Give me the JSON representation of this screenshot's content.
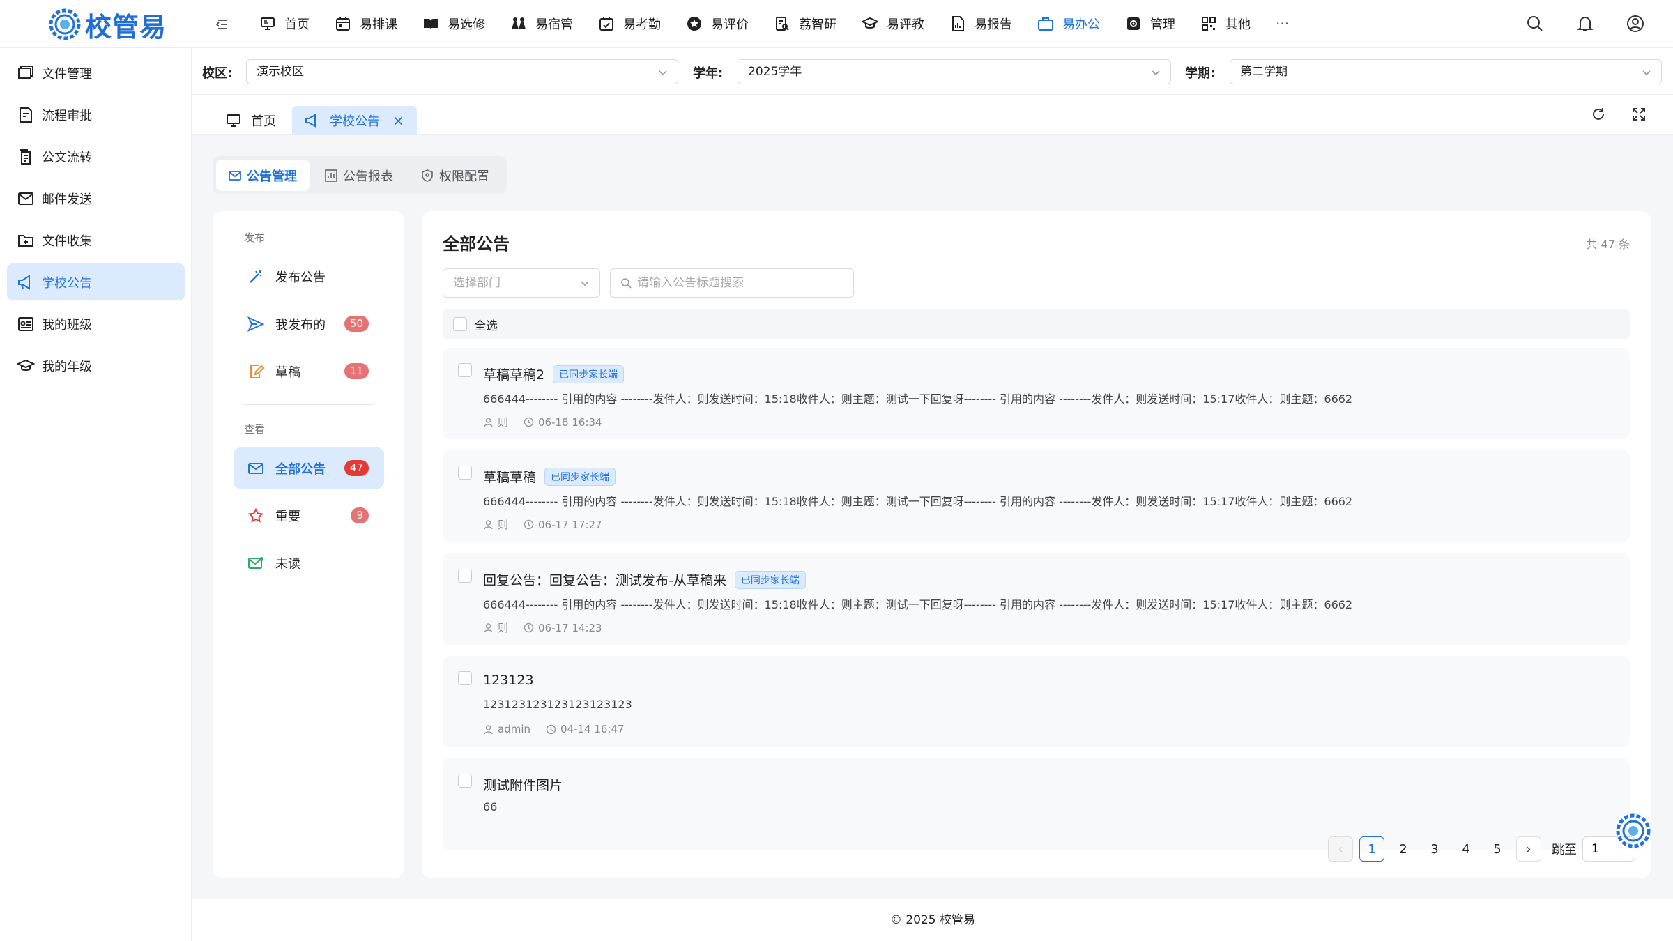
{
  "brand": {
    "name": "校管易",
    "accent": "#1f73d9"
  },
  "nav": {
    "items": [
      {
        "label": "首页",
        "icon": "monitor-icon"
      },
      {
        "label": "易排课",
        "icon": "calendar-icon"
      },
      {
        "label": "易选修",
        "icon": "book-open-icon"
      },
      {
        "label": "易宿管",
        "icon": "people-icon"
      },
      {
        "label": "易考勤",
        "icon": "calendar-check-icon"
      },
      {
        "label": "易评价",
        "icon": "star-badge-icon"
      },
      {
        "label": "荔智研",
        "icon": "research-icon"
      },
      {
        "label": "易评教",
        "icon": "graduation-cap-icon"
      },
      {
        "label": "易报告",
        "icon": "report-file-icon"
      },
      {
        "label": "易办公",
        "icon": "briefcase-icon"
      },
      {
        "label": "管理",
        "icon": "settings-box-icon"
      },
      {
        "label": "其他",
        "icon": "grid-icon"
      }
    ],
    "more": "···"
  },
  "sidebar": {
    "items": [
      {
        "label": "文件管理",
        "icon": "folder-icon"
      },
      {
        "label": "流程审批",
        "icon": "approval-doc-icon"
      },
      {
        "label": "公文流转",
        "icon": "documents-icon"
      },
      {
        "label": "邮件发送",
        "icon": "mail-icon"
      },
      {
        "label": "文件收集",
        "icon": "folder-plus-icon"
      },
      {
        "label": "学校公告",
        "icon": "megaphone-icon"
      },
      {
        "label": "我的班级",
        "icon": "class-board-icon"
      },
      {
        "label": "我的年级",
        "icon": "graduation-cap-icon"
      }
    ]
  },
  "filters": {
    "campus_label": "校区:",
    "campus_value": "演示校区",
    "year_label": "学年:",
    "year_value": "2025学年",
    "term_label": "学期:",
    "term_value": "第二学期"
  },
  "tabs": {
    "home": "首页",
    "current": "学校公告",
    "close": "×"
  },
  "subtabs": [
    "公告管理",
    "公告报表",
    "权限配置"
  ],
  "leftpanel": {
    "publish_section": "发布",
    "view_section": "查看",
    "publish_items": [
      {
        "label": "发布公告",
        "badge": ""
      },
      {
        "label": "我发布的",
        "badge": "50"
      },
      {
        "label": "草稿",
        "badge": "11"
      }
    ],
    "view_items": [
      {
        "label": "全部公告",
        "badge": "47"
      },
      {
        "label": "重要",
        "badge": "9"
      },
      {
        "label": "未读",
        "badge": ""
      }
    ]
  },
  "main": {
    "title": "全部公告",
    "count": "共 47 条",
    "dept_placeholder": "选择部门",
    "search_placeholder": "请输入公告标题搜索",
    "select_all": "全选"
  },
  "announcements": [
    {
      "title": "草稿草稿2",
      "tag": "已同步家长端",
      "summary": "666444-------- 引用的内容 --------发件人：则发送时间：15:18收件人：则主题：测试一下回复呀-------- 引用的内容 --------发件人：则发送时间：15:17收件人：则主题：6662",
      "author": "则",
      "time": "06-18 16:34"
    },
    {
      "title": "草稿草稿",
      "tag": "已同步家长端",
      "summary": "666444-------- 引用的内容 --------发件人：则发送时间：15:18收件人：则主题：测试一下回复呀-------- 引用的内容 --------发件人：则发送时间：15:17收件人：则主题：6662",
      "author": "则",
      "time": "06-17 17:27"
    },
    {
      "title": "回复公告：回复公告：测试发布-从草稿来",
      "tag": "已同步家长端",
      "summary": "666444-------- 引用的内容 --------发件人：则发送时间：15:18收件人：则主题：测试一下回复呀-------- 引用的内容 --------发件人：则发送时间：15:17收件人：则主题：6662",
      "author": "则",
      "time": "06-17 14:23"
    },
    {
      "title": "123123",
      "tag": "",
      "summary": "123123123123123123123",
      "author": "admin",
      "time": "04-14 16:47"
    },
    {
      "title": "测试附件图片",
      "tag": "",
      "summary": "66",
      "author": "",
      "time": ""
    }
  ],
  "pager": {
    "pages": [
      "1",
      "2",
      "3",
      "4",
      "5"
    ],
    "current": "1",
    "jump_label": "跳至",
    "jump_value": "1",
    "prev": "‹",
    "next": "›"
  },
  "footer": "© 2025 校管易"
}
